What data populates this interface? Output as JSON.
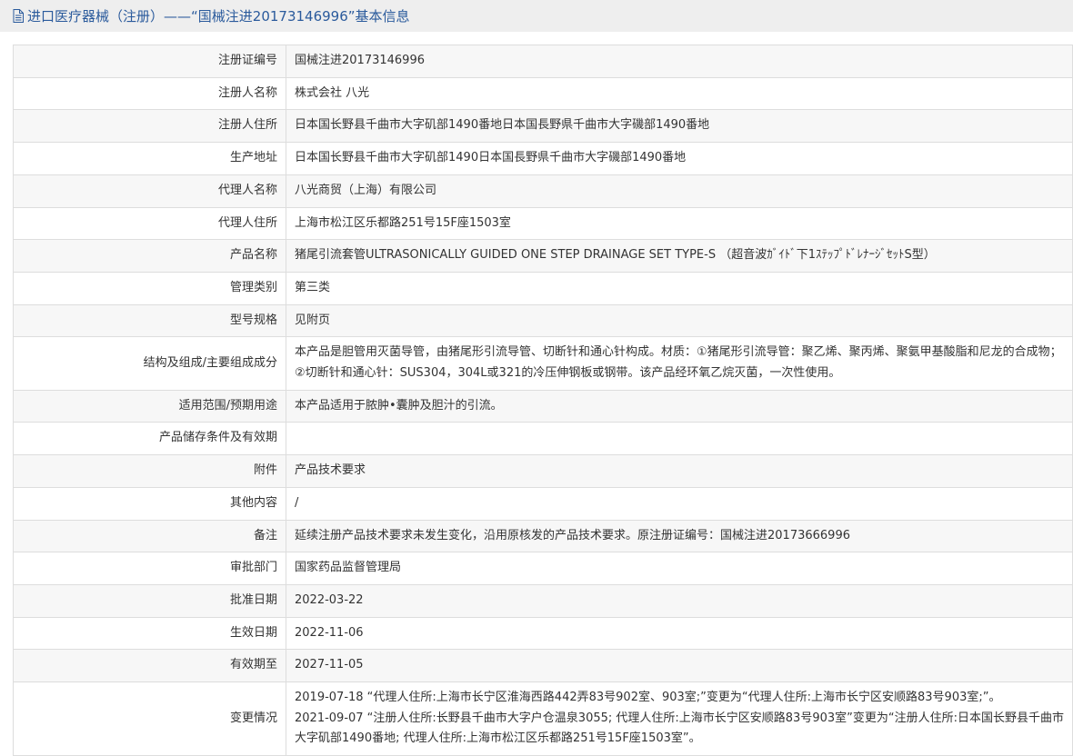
{
  "header": {
    "icon": "document-icon",
    "title": "进口医疗器械（注册）——“国械注进20173146996”基本信息"
  },
  "rows": [
    {
      "label": "注册证编号",
      "value": "国械注进20173146996"
    },
    {
      "label": "注册人名称",
      "value": "株式会社 八光"
    },
    {
      "label": "注册人住所",
      "value": "日本国长野县千曲市大字矶部1490番地日本国長野県千曲市大字磯部1490番地"
    },
    {
      "label": "生产地址",
      "value": "日本国长野县千曲市大字矶部1490日本国長野県千曲市大字磯部1490番地"
    },
    {
      "label": "代理人名称",
      "value": "八光商贸（上海）有限公司"
    },
    {
      "label": "代理人住所",
      "value": "上海市松江区乐都路251号15F座1503室"
    },
    {
      "label": "产品名称",
      "value": "猪尾引流套管ULTRASONICALLY GUIDED ONE STEP DRAINAGE SET TYPE-S （超音波ｶﾞｲﾄﾞ下1ｽﾃｯﾌﾟﾄﾞﾚﾅｰｼﾞｾｯﾄS型）"
    },
    {
      "label": "管理类别",
      "value": "第三类"
    },
    {
      "label": "型号规格",
      "value": "见附页"
    },
    {
      "label": "结构及组成/主要组成成分",
      "value": "本产品是胆管用灭菌导管，由猪尾形引流导管、切断针和通心针构成。材质：①猪尾形引流导管：聚乙烯、聚丙烯、聚氨甲基酸脂和尼龙的合成物；②切断针和通心针：SUS304，304L或321的冷压伸钢板或钢带。该产品经环氧乙烷灭菌，一次性使用。"
    },
    {
      "label": "适用范围/预期用途",
      "value": "本产品适用于脓肿•囊肿及胆汁的引流。"
    },
    {
      "label": "产品储存条件及有效期",
      "value": ""
    },
    {
      "label": "附件",
      "value": "产品技术要求"
    },
    {
      "label": "其他内容",
      "value": "/"
    },
    {
      "label": "备注",
      "value": "延续注册产品技术要求未发生变化，沿用原核发的产品技术要求。原注册证编号：国械注进20173666996"
    },
    {
      "label": "审批部门",
      "value": "国家药品监督管理局"
    },
    {
      "label": "批准日期",
      "value": "2022-03-22"
    },
    {
      "label": "生效日期",
      "value": "2022-11-06"
    },
    {
      "label": "有效期至",
      "value": "2027-11-05"
    }
  ],
  "changes": {
    "label": "变更情况",
    "lines": [
      "2019-07-18 “代理人住所:上海市长宁区淮海西路442弄83号902室、903室;”变更为“代理人住所:上海市长宁区安顺路83号903室;”。",
      "2021-09-07 “注册人住所:长野县千曲市大字户仓温泉3055; 代理人住所:上海市长宁区安顺路83号903室”变更为“注册人住所:日本国长野县千曲市大字矶部1490番地; 代理人住所:上海市松江区乐都路251号15F座1503室”。"
    ]
  }
}
